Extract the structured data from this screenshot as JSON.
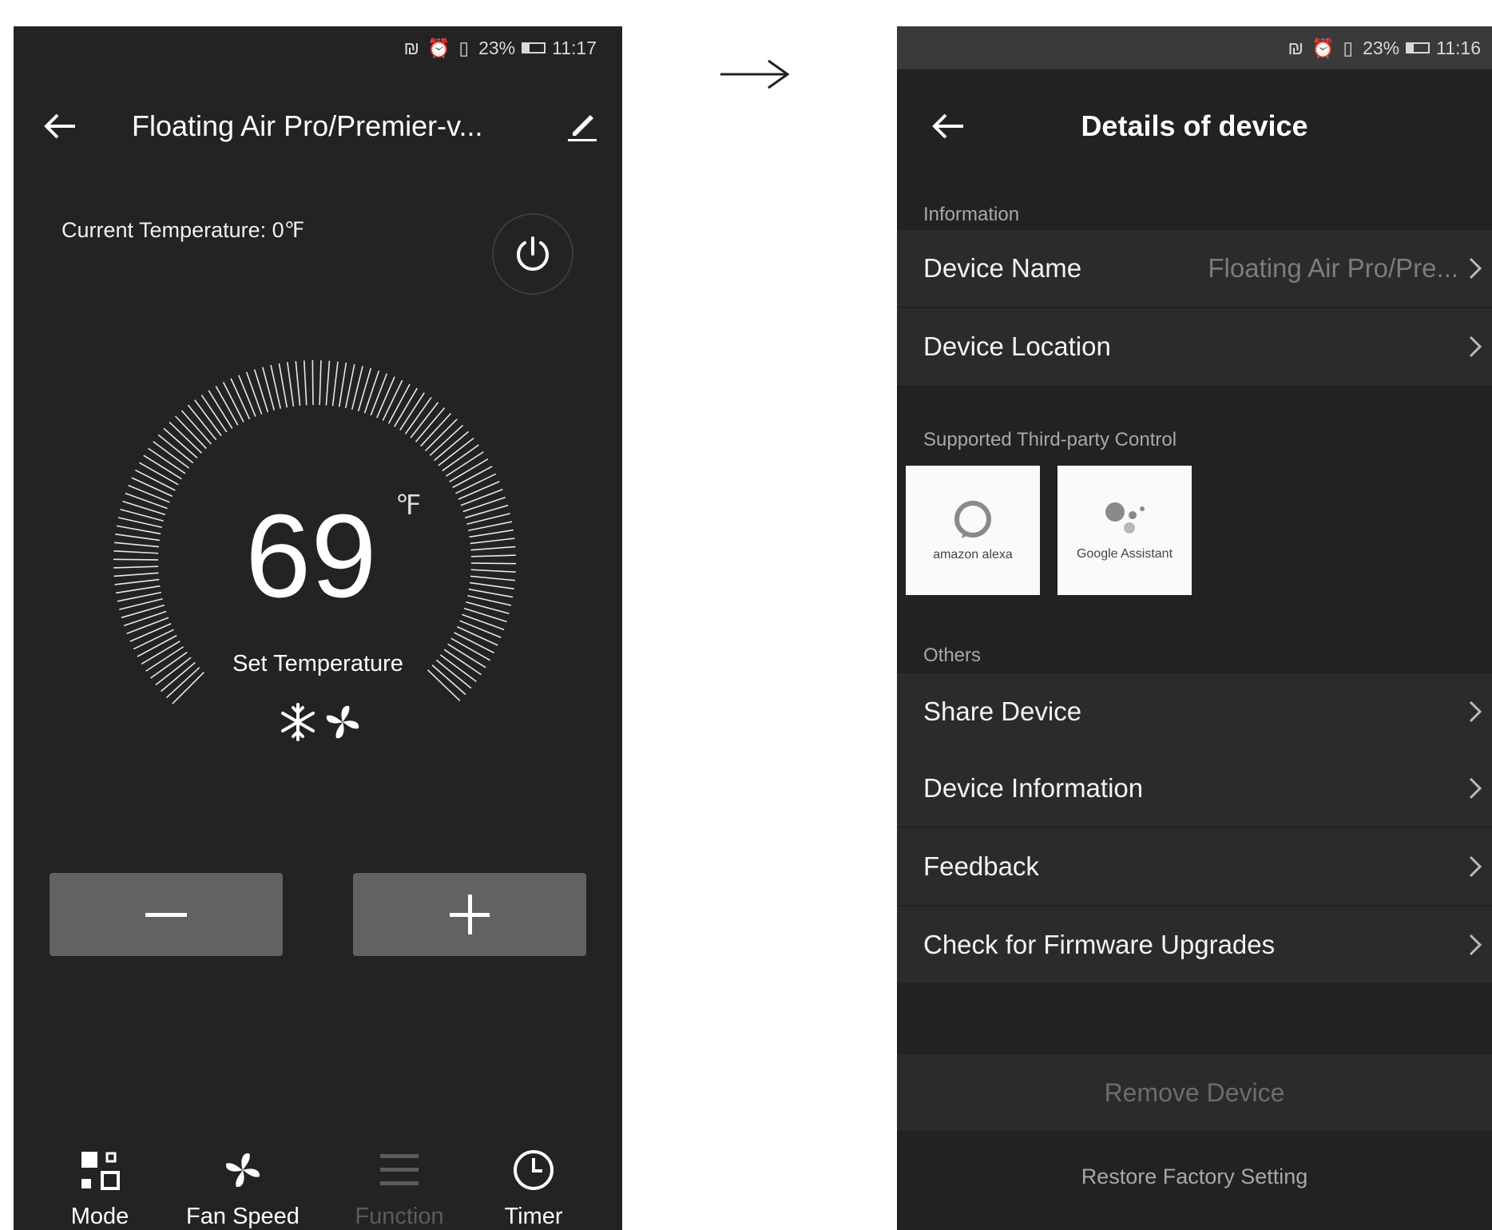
{
  "left": {
    "status": {
      "icons": "₪ ⏰ ▯",
      "battery": "23%",
      "time": "11:17"
    },
    "title": "Floating Air Pro/Premier-v...",
    "current_temperature": "Current Temperature: 0℉",
    "set_temperature_value": "69",
    "unit": "℉",
    "set_temperature_label": "Set Temperature",
    "minus_label": "−",
    "plus_label": "+",
    "tabs": [
      {
        "label": "Mode",
        "icon": "mode-icon"
      },
      {
        "label": "Fan Speed",
        "icon": "fan-icon"
      },
      {
        "label": "Function",
        "icon": "menu-icon",
        "disabled": true
      },
      {
        "label": "Timer",
        "icon": "clock-icon"
      }
    ]
  },
  "right": {
    "status": {
      "icons": "₪ ⏰ ▯",
      "battery": "23%",
      "time": "11:16"
    },
    "title": "Details of device",
    "section_information": "Information",
    "device_name_label": "Device Name",
    "device_name_value": "Floating Air Pro/Pre...",
    "device_location_label": "Device Location",
    "section_third_party": "Supported Third-party Control",
    "alexa_caption": "amazon alexa",
    "google_caption": "Google Assistant",
    "section_others": "Others",
    "share_device": "Share Device",
    "device_information": "Device Information",
    "feedback": "Feedback",
    "firmware": "Check for Firmware Upgrades",
    "remove_device": "Remove Device",
    "restore_factory": "Restore Factory Setting"
  },
  "colors": {
    "background": "#242223",
    "button": "#636263",
    "row": "#2c2b2c",
    "muted": "#7d7c7d"
  }
}
